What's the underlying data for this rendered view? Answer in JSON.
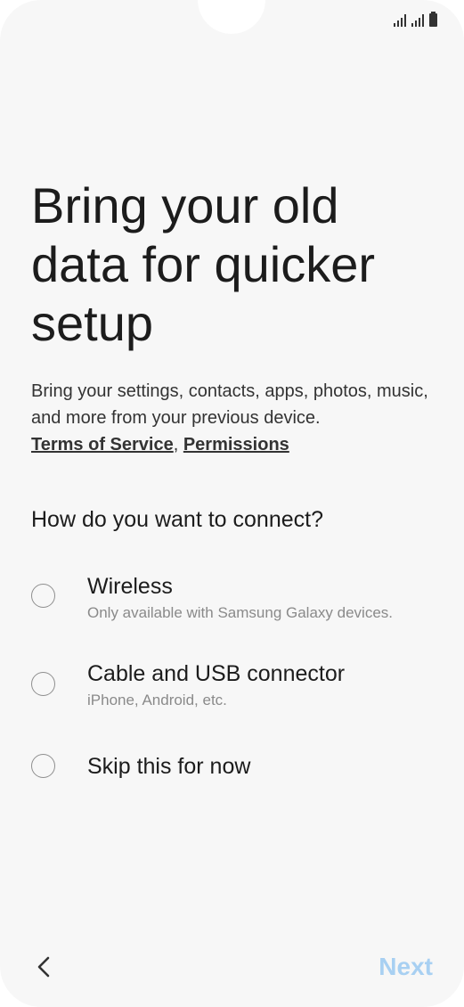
{
  "status_bar": {
    "signal_1_icon": "signal-icon",
    "signal_2_icon": "signal-icon",
    "battery_icon": "battery-icon"
  },
  "page": {
    "title": "Bring your old data for quicker setup",
    "description": "Bring your settings, contacts, apps, photos, music, and more from your previous device.",
    "terms_link": "Terms of Service",
    "separator": ",",
    "permissions_link": "Permissions",
    "question": "How do you want to connect?"
  },
  "options": [
    {
      "label": "Wireless",
      "sublabel": "Only available with Samsung Galaxy devices.",
      "selected": false
    },
    {
      "label": "Cable and USB connector",
      "sublabel": "iPhone, Android, etc.",
      "selected": false
    },
    {
      "label": "Skip this for now",
      "sublabel": "",
      "selected": false
    }
  ],
  "footer": {
    "back_icon": "chevron-left-icon",
    "next_label": "Next",
    "next_color": "#a8d0f2"
  }
}
